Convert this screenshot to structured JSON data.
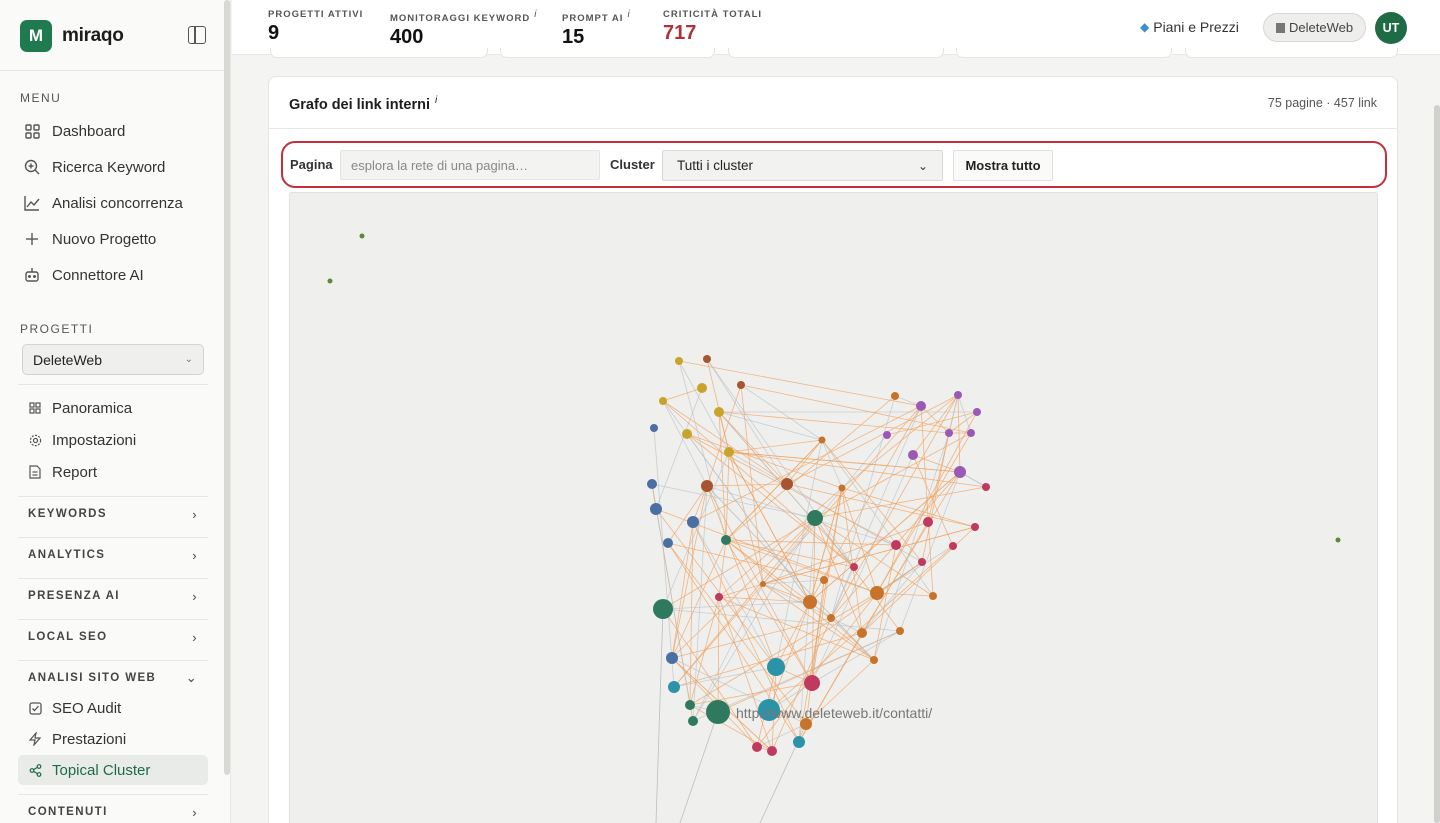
{
  "brand": {
    "name": "miraqo",
    "logo_letter": "M",
    "color": "#1f7a4f"
  },
  "sidebar": {
    "menu_label": "MENU",
    "menu": [
      {
        "label": "Dashboard",
        "icon": "grid-icon"
      },
      {
        "label": "Ricerca Keyword",
        "icon": "search-icon"
      },
      {
        "label": "Analisi concorrenza",
        "icon": "chart-line-icon"
      },
      {
        "label": "Nuovo Progetto",
        "icon": "plus-icon"
      },
      {
        "label": "Connettore AI",
        "icon": "robot-icon"
      }
    ],
    "projects_label": "PROGETTI",
    "project_selected": "DeleteWeb",
    "project_items": [
      {
        "label": "Panoramica",
        "icon": "grid-icon"
      },
      {
        "label": "Impostazioni",
        "icon": "gear-icon"
      },
      {
        "label": "Report",
        "icon": "document-icon"
      }
    ],
    "groups": [
      {
        "label": "KEYWORDS",
        "expanded": false
      },
      {
        "label": "ANALYTICS",
        "expanded": false
      },
      {
        "label": "PRESENZA AI",
        "expanded": false
      },
      {
        "label": "LOCAL SEO",
        "expanded": false
      },
      {
        "label": "ANALISI SITO WEB",
        "expanded": true
      },
      {
        "label": "CONTENUTI",
        "expanded": false
      }
    ],
    "site_items": [
      {
        "label": "SEO Audit",
        "icon": "checkbox-icon",
        "active": false
      },
      {
        "label": "Prestazioni",
        "icon": "bolt-icon",
        "active": false
      },
      {
        "label": "Topical Cluster",
        "icon": "share-icon",
        "active": true
      }
    ]
  },
  "topbar": {
    "stats": [
      {
        "label": "PROGETTI ATTIVI",
        "value": "9",
        "info": ""
      },
      {
        "label": "MONITORAGGI KEYWORD",
        "value": "400",
        "info": "i"
      },
      {
        "label": "PROMPT AI",
        "value": "15",
        "info": "i"
      },
      {
        "label": "CRITICITÀ TOTALI",
        "value": "717",
        "info": ""
      }
    ],
    "plans_label": "Piani e Prezzi",
    "project_pill": "DeleteWeb",
    "avatar_initials": "UT"
  },
  "card": {
    "title": "Grafo dei link interni",
    "title_info": "i",
    "meta": "75 pagine · 457 link",
    "filter": {
      "page_label": "Pagina",
      "page_placeholder": "esplora la rete di una pagina…",
      "cluster_label": "Cluster",
      "cluster_selected": "Tutti i cluster",
      "show_all_label": "Mostra tutto"
    },
    "graph": {
      "hover_label": "http://www.deleteweb.it/contatti/",
      "cluster_colors": {
        "yellow": "#c8a42a",
        "brown": "#a8552f",
        "purple": "#9b59b6",
        "blue": "#4a6fa5",
        "green": "#2f7a5f",
        "magenta": "#c0395e",
        "orange": "#c7732a",
        "teal": "#2b93a8",
        "olive": "#5a8a3a"
      },
      "edge_color": "#f2a15c",
      "edge_color_light": "#b8c0c4"
    }
  }
}
